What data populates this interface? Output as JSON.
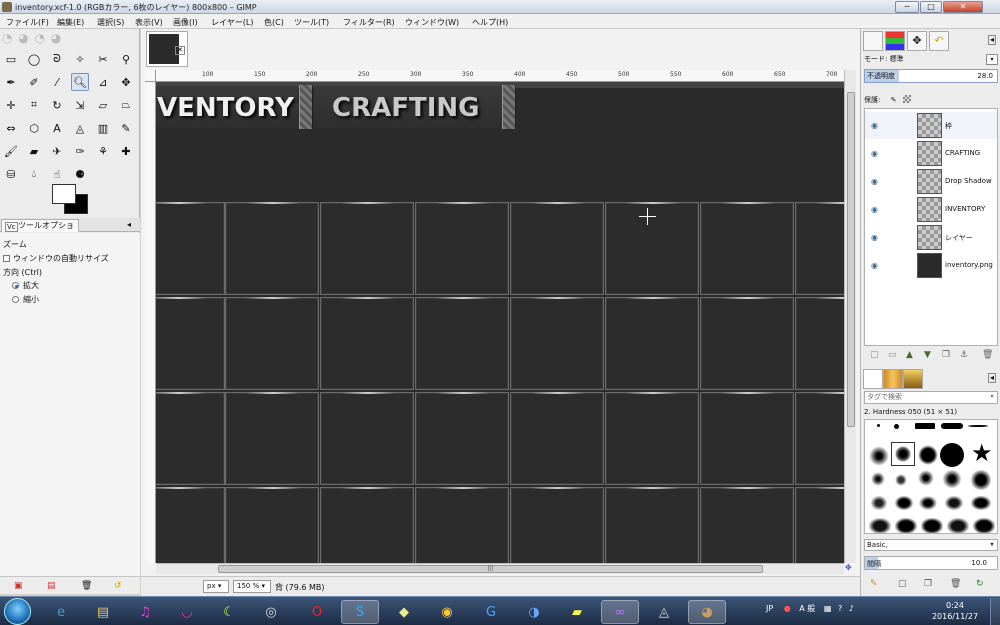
{
  "window": {
    "title": "inventory.xcf-1.0 (RGBカラー, 6枚のレイヤー) 800x800 – GIMP",
    "minimize": "─",
    "maximize": "□",
    "close": "✕"
  },
  "menu": [
    "ファイル(F)",
    "編集(E)",
    "選択(S)",
    "表示(V)",
    "画像(I)",
    "レイヤー(L)",
    "色(C)",
    "ツール(T)",
    "フィルター(R)",
    "ウィンドウ(W)",
    "ヘルプ(H)"
  ],
  "toolbox": {
    "tools": [
      "rect-select",
      "ellipse-select",
      "free-select",
      "fuzzy-select",
      "scissors",
      "foreground-select",
      "paths",
      "color-picker",
      "zoom",
      "measure",
      "move",
      "align",
      "crop",
      "rotate",
      "scale",
      "shear",
      "perspective",
      "flip",
      "cage",
      "warp",
      "unified-transform",
      "text",
      "bucket-fill",
      "blend",
      "pencil",
      "paintbrush",
      "eraser",
      "airbrush",
      "ink",
      "mybrush",
      "clone",
      "heal",
      "perspective-clone",
      "blur",
      "smudge",
      "dodge"
    ],
    "active_tool": "zoom"
  },
  "tool_options": {
    "tab_label": "ツールオプション",
    "tool_name": "ズーム",
    "auto_resize_label": "ウィンドウの自動リサイズ",
    "direction_label": "方向 (Ctrl)",
    "zoom_in_label": "拡大",
    "zoom_out_label": "縮小",
    "direction_selected": "zoom-in"
  },
  "ruler": {
    "h_ticks": [
      "100",
      "150",
      "200",
      "250",
      "300",
      "350",
      "400",
      "450",
      "500",
      "550",
      "600",
      "650",
      "700"
    ]
  },
  "canvas": {
    "title_inventory": "VENTORY",
    "title_crafting": "CRAFTING"
  },
  "statusbar": {
    "unit": "px",
    "zoom": "150 %",
    "info": "背 (79.6 MB)"
  },
  "layers_panel": {
    "mode_label": "モード: 標準",
    "opacity_label": "不透明度",
    "opacity_value": "28.0",
    "lock_label": "保護:",
    "layers": [
      {
        "name": "枠",
        "dark": false
      },
      {
        "name": "CRAFTING",
        "dark": false
      },
      {
        "name": "Drop Shadow",
        "dark": false
      },
      {
        "name": "INVENTORY",
        "dark": false
      },
      {
        "name": "レイヤー",
        "dark": false
      },
      {
        "name": "inventory.png",
        "dark": true
      }
    ]
  },
  "brushes_panel": {
    "tag_placeholder": "タグで検索",
    "selected_brush": "2. Hardness 050 (51 × 51)",
    "preset": "Basic,",
    "spacing_label": "間隔",
    "spacing_value": "10.0"
  },
  "taskbar": {
    "apps": [
      "ie",
      "explorer",
      "itunes",
      "lips",
      "c-app",
      "obs",
      "opera",
      "skype",
      "folder-app",
      "chrome",
      "app-g",
      "app-b",
      "sticky",
      "visual-studio",
      "unity",
      "gimp"
    ],
    "tray_lang": "JP",
    "tray_ime": "A 般",
    "clock_time": "0:24",
    "clock_date": "2016/11/27"
  }
}
